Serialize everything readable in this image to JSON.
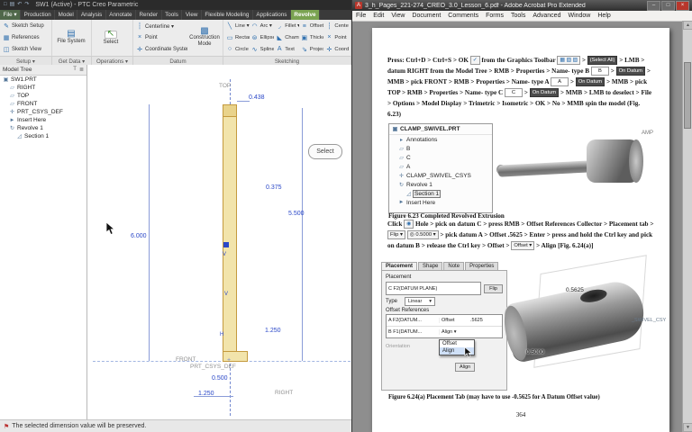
{
  "creo": {
    "title": "SW1 (Active) - PTC Creo Parametric",
    "qat_icons": [
      "□",
      "▤",
      "↶",
      "↷"
    ],
    "tabs": [
      {
        "v": "File ▾",
        "cls": "t-file"
      },
      {
        "v": "Production"
      },
      {
        "v": "Model"
      },
      {
        "v": "Analysis"
      },
      {
        "v": "Annotate"
      },
      {
        "v": "Render"
      },
      {
        "v": "Tools"
      },
      {
        "v": "View"
      },
      {
        "v": "Flexible Modeling"
      },
      {
        "v": "Applications"
      },
      {
        "v": "Revolve",
        "cls": "t-active"
      }
    ],
    "setup": [
      {
        "icon": "✎",
        "v": "Sketch Setup"
      },
      {
        "icon": "▦",
        "v": "References"
      },
      {
        "icon": "◫",
        "v": "Sketch View"
      }
    ],
    "get_data": {
      "icon": "▤",
      "label": "File System"
    },
    "operations": {
      "icon": "↖",
      "label": "Select"
    },
    "datum": [
      {
        "icon": "┆",
        "v": "Centerline ▾"
      },
      {
        "icon": "×",
        "v": "Point"
      },
      {
        "icon": "✛",
        "v": "Coordinate System"
      }
    ],
    "construction": {
      "icon": "▩",
      "label": "Construction Mode"
    },
    "sketching": [
      {
        "icon": "╲",
        "v": "Line ▾"
      },
      {
        "icon": "▭",
        "v": "Rectangle ▾"
      },
      {
        "icon": "○",
        "v": "Circle ▾"
      },
      {
        "icon": "◠",
        "v": "Arc ▾"
      },
      {
        "icon": "⊜",
        "v": "Ellipse ▾"
      },
      {
        "icon": "∿",
        "v": "Spline"
      },
      {
        "icon": "◞",
        "v": "Fillet ▾"
      },
      {
        "icon": "◣",
        "v": "Chamfer ▾"
      },
      {
        "icon": "A",
        "v": "Text"
      },
      {
        "icon": "≡",
        "v": "Offset"
      },
      {
        "icon": "▣",
        "v": "Thicken"
      },
      {
        "icon": "⇘",
        "v": "Project"
      },
      {
        "icon": "┆",
        "v": "Centerline ▾"
      },
      {
        "icon": "×",
        "v": "Point"
      },
      {
        "icon": "✛",
        "v": "Coordinate System"
      }
    ],
    "groups": [
      {
        "v": "Setup ▾"
      },
      {
        "v": "Get Data ▾"
      },
      {
        "v": "Operations ▾"
      },
      {
        "v": "Datum"
      },
      {
        "v": "Sketching"
      }
    ],
    "model_tree": {
      "title": "Model Tree",
      "header_icons": [
        "T",
        "≣"
      ],
      "items": [
        {
          "icon": "▣",
          "v": "SW1.PRT"
        },
        {
          "icon": "▱",
          "v": "RIGHT",
          "cls": "ind1"
        },
        {
          "icon": "▱",
          "v": "TOP",
          "cls": "ind1"
        },
        {
          "icon": "▱",
          "v": "FRONT",
          "cls": "ind1"
        },
        {
          "icon": "✛",
          "v": "PRT_CSYS_DEF",
          "cls": "ind1"
        },
        {
          "icon": "►",
          "v": "Insert Here",
          "cls": "ind1"
        },
        {
          "icon": "↻",
          "v": "Revolve 1",
          "cls": "ind1"
        },
        {
          "icon": "◿",
          "v": "Section 1",
          "cls": "ind2"
        }
      ]
    },
    "sketch": {
      "dims": {
        "d0438": "0.438",
        "d0375": "0.375",
        "d5500": "5.500",
        "d6000": "6.000",
        "d1250a": "1.250",
        "d0500": "0.500",
        "d1250b": "1.250"
      },
      "labels": {
        "top": "TOP",
        "front": "FRONT",
        "csys": "PRT_CSYS_DEF",
        "right": "RIGHT"
      },
      "constraints": {
        "v": "V",
        "h": "H"
      },
      "origin": "+",
      "select_flag": "Select"
    },
    "status_icon": "⚑",
    "status": "The selected dimension value will be preserved."
  },
  "acrobat": {
    "title": "3_h_Pages_221-274_CREO_3.0_Lesson_6.pdf - Adobe Acrobat Pro Extended",
    "app_icon": "A",
    "win_min": "–",
    "win_max": "□",
    "win_close": "×",
    "menus": [
      "File",
      "Edit",
      "View",
      "Document",
      "Comments",
      "Forms",
      "Tools",
      "Advanced",
      "Window",
      "Help"
    ],
    "scroll_up": "▲",
    "scroll_down": "▼",
    "para1": [
      {
        "v": "Press: Ctrl+D > Ctrl+S > OK "
      },
      {
        "v": "✓",
        "cls": "chip ic"
      },
      {
        "v": " from the Graphics Toolbar "
      },
      {
        "v": "▦ ▧ ▨",
        "cls": "chip ic"
      },
      {
        "v": " > "
      },
      {
        "v": "(Select All)",
        "cls": "chip dk"
      },
      {
        "v": " > LMB > datum RIGHT from the Model Tree > RMB > Properties > Name- type B "
      },
      {
        "v": "B",
        "cls": "chip in"
      },
      {
        "v": " > "
      },
      {
        "v": "On Datum",
        "cls": "chip dk"
      },
      {
        "v": " > MMB > pick FRONT > RMB > Properties > Name- type A "
      },
      {
        "v": "A",
        "cls": "chip in"
      },
      {
        "v": " > "
      },
      {
        "v": "On Datum",
        "cls": "chip dk"
      },
      {
        "v": " > MMB > pick TOP > RMB > Properties > Name- type C "
      },
      {
        "v": "C",
        "cls": "chip in"
      },
      {
        "v": " > "
      },
      {
        "v": "On Datum",
        "cls": "chip dk"
      },
      {
        "v": " > MMB > LMB to deselect > File > Options > Model Display > Trimetric > Isometric > OK > No > MMB spin the model (Fig. 6.23)"
      }
    ],
    "fig623": {
      "root_icon": "▣",
      "tree_title": "CLAMP_SWIVEL.PRT",
      "tree_items": [
        {
          "icon": "▸",
          "v": "Annotations",
          "cls": "ind1"
        },
        {
          "icon": "▱",
          "v": "B",
          "cls": "ind1"
        },
        {
          "icon": "▱",
          "v": "C",
          "cls": "ind1"
        },
        {
          "icon": "▱",
          "v": "A",
          "cls": "ind1"
        },
        {
          "icon": "✛",
          "v": "CLAMP_SWIVEL_CSYS",
          "cls": "ind1"
        },
        {
          "icon": "↻",
          "v": "Revolve 1",
          "cls": "ind1"
        },
        {
          "icon": "◿",
          "v": "Section 1",
          "cls": "ind2 sel"
        },
        {
          "icon": "►",
          "v": "Insert Here",
          "cls": "ind1"
        }
      ],
      "model_label": "AMP",
      "caption": "Figure 6.23 Completed Revolved Extrusion"
    },
    "para2": [
      {
        "v": "Click "
      },
      {
        "v": "◉",
        "cls": "chip ic"
      },
      {
        "v": " Hole > pick on datum C > press RMB > Offset References Collector > Placement tab > "
      },
      {
        "v": "Flip ▾",
        "cls": "chip"
      },
      {
        "v": " "
      },
      {
        "v": "◎ 0.5000 ▾",
        "cls": "chip"
      },
      {
        "v": " > pick datum A > Offset .5625 > Enter > press and hold the Ctrl key and pick on datum B > release the Ctrl key > Offset > "
      },
      {
        "v": "Offset ▾",
        "cls": "chip"
      },
      {
        "v": " > Align [Fig. 6.24(a)]"
      }
    ],
    "fig624": {
      "tabs": [
        {
          "v": "Placement",
          "cls": "active"
        },
        {
          "v": "Shape"
        },
        {
          "v": "Note"
        },
        {
          "v": "Properties"
        }
      ],
      "placement_label": "Placement",
      "primary_ref": "C F2(DATUM PLANE)",
      "flip": "Flip",
      "type_label": "Type",
      "type_value": "Linear",
      "caret": "▾",
      "offset_refs_label": "Offset References",
      "refs": [
        {
          "name": "A F2(DATUM...",
          "mode": "Offset",
          "val": ".5625"
        },
        {
          "name": "B F1(DATUM...",
          "mode": "Align ▾",
          "val": ""
        }
      ],
      "orientation_label": "Orientation",
      "dropdown_options": [
        {
          "v": "Offset"
        },
        {
          "v": "Align",
          "cls": "hov"
        }
      ],
      "align_chip": "Align",
      "dim1": "0.5625",
      "dim2": "0.5000",
      "csys_label": "_SWIVEL_CSY",
      "caption": "Figure 6.24(a) Placement Tab (may have to use -0.5625 for A Datum Offset value)"
    },
    "page_number": "364"
  }
}
